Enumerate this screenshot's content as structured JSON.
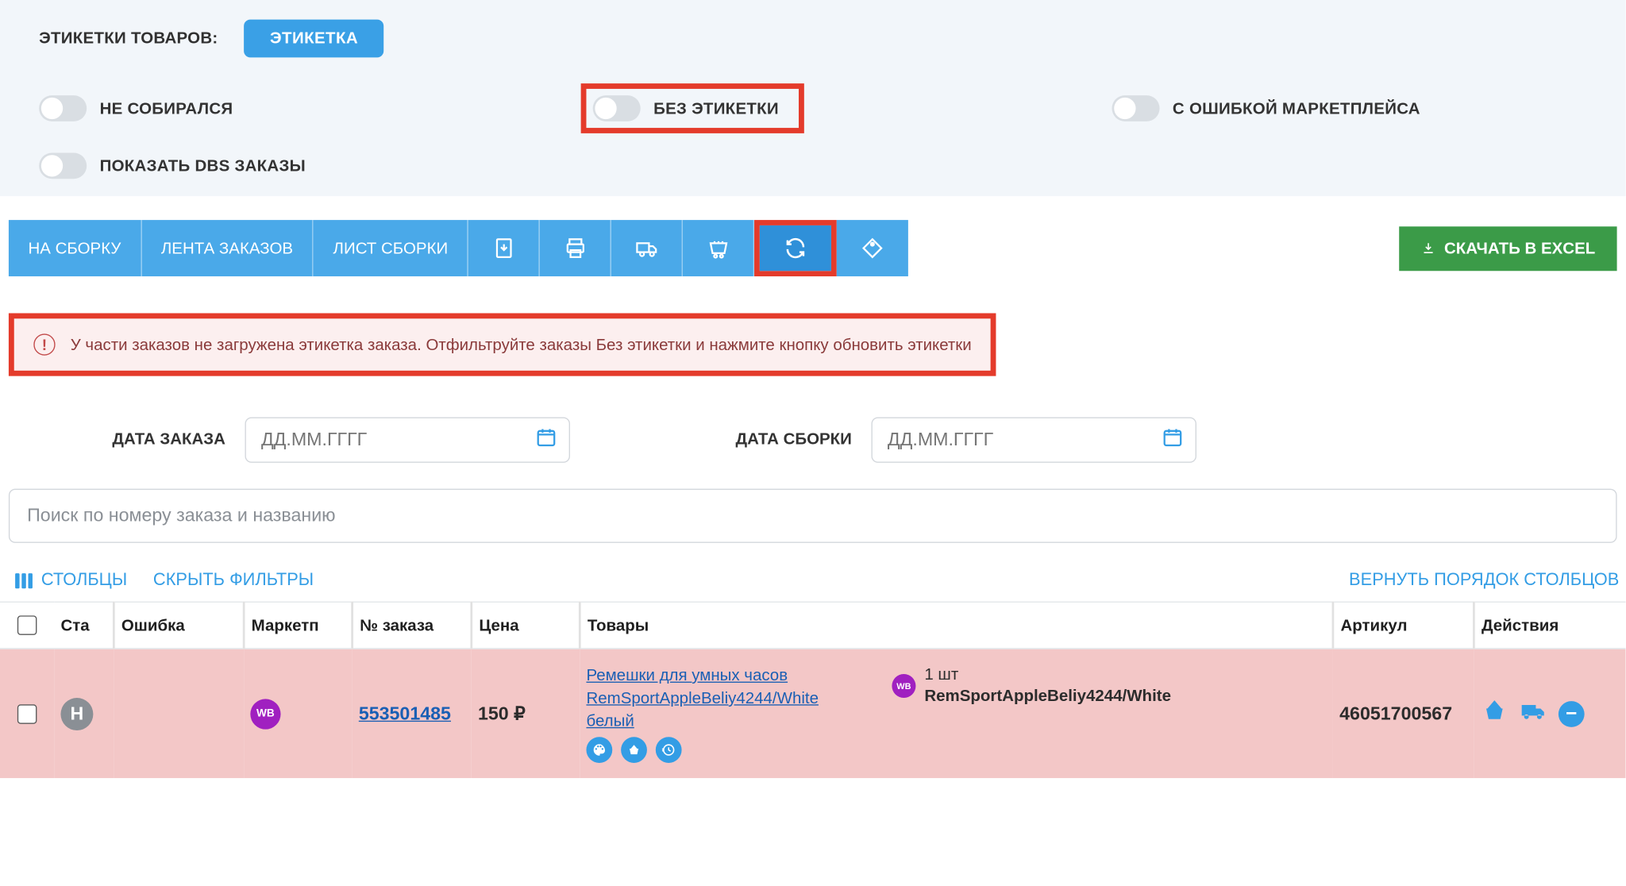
{
  "header": {
    "labels_title": "ЭТИКЕТКИ ТОВАРОВ:",
    "label_button": "ЭТИКЕТКА"
  },
  "toggles": {
    "not_assembled": "НЕ СОБИРАЛСЯ",
    "no_label": "БЕЗ ЭТИКЕТКИ",
    "marketplace_error": "С ОШИБКОЙ МАРКЕТПЛЕЙСА",
    "show_dbs": "ПОКАЗАТЬ DBS ЗАКАЗЫ"
  },
  "toolbar": {
    "to_assembly": "НА СБОРКУ",
    "order_feed": "ЛЕНТА ЗАКАЗОВ",
    "assembly_sheet": "ЛИСТ СБОРКИ",
    "download_excel": "СКАЧАТЬ В EXCEL"
  },
  "alert": {
    "text": "У части заказов не загружена этикетка заказа. Отфильтруйте заказы Без этикетки и нажмите кнопку обновить этикетки"
  },
  "dates": {
    "order_label": "ДАТА ЗАКАЗА",
    "assembly_label": "ДАТА СБОРКИ",
    "placeholder": "ДД.ММ.ГГГГ"
  },
  "search": {
    "placeholder": "Поиск по номеру заказа и названию"
  },
  "table_ctrl": {
    "columns": "СТОЛБЦЫ",
    "hide_filters": "СКРЫТЬ ФИЛЬТРЫ",
    "reset_columns": "ВЕРНУТЬ ПОРЯДОК СТОЛБЦОВ"
  },
  "columns": {
    "status": "Ста",
    "error": "Ошибка",
    "marketplace": "Маркетп",
    "order_no": "№ заказа",
    "price": "Цена",
    "products": "Товары",
    "article": "Артикул",
    "actions": "Действия"
  },
  "rows": [
    {
      "status_letter": "Н",
      "marketplace_badge": "WB",
      "order_no": "553501485",
      "price": "150 ₽",
      "product_line1": "Ремешки для умных часов",
      "product_line2": "RemSportAppleBeliy4244/White",
      "product_line3": "белый",
      "qty": "1 шт",
      "sku": "RemSportAppleBeliy4244/White",
      "article": "46051700567"
    }
  ]
}
